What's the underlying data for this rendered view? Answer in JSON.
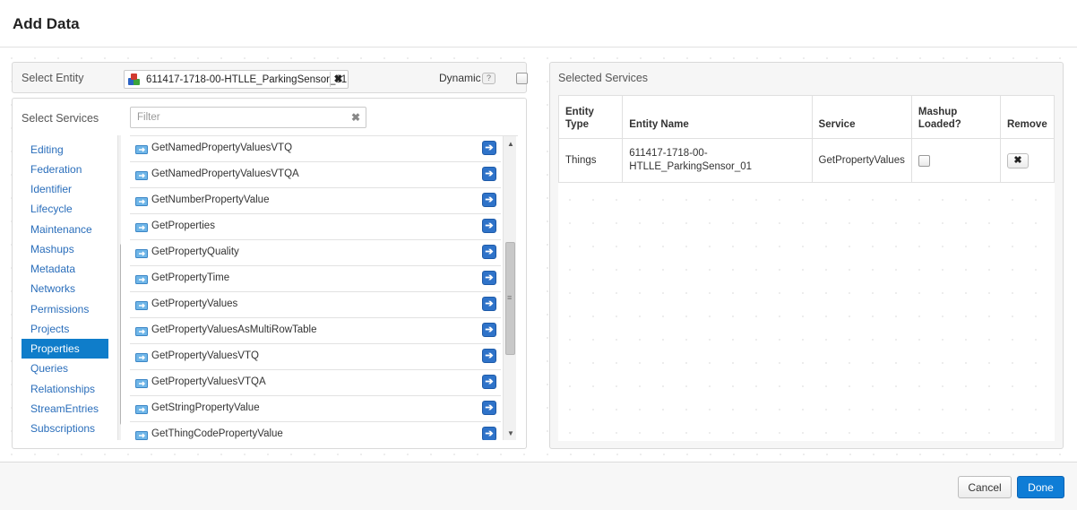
{
  "dialog": {
    "title": "Add Data"
  },
  "entity": {
    "label": "Select Entity",
    "selected": "611417-1718-00-HTLLE_ParkingSensor_01",
    "dynamic_label": "Dynamic",
    "help_badge": "?",
    "remove_glyph": "✖"
  },
  "services": {
    "label": "Select Services",
    "filter_placeholder": "Filter",
    "filter_clear_glyph": "✖",
    "categories": [
      {
        "label": "Editing"
      },
      {
        "label": "Federation"
      },
      {
        "label": "Identifier"
      },
      {
        "label": "Lifecycle"
      },
      {
        "label": "Maintenance"
      },
      {
        "label": "Mashups"
      },
      {
        "label": "Metadata"
      },
      {
        "label": "Networks"
      },
      {
        "label": "Permissions"
      },
      {
        "label": "Projects"
      },
      {
        "label": "Properties"
      },
      {
        "label": "Queries"
      },
      {
        "label": "Relationships"
      },
      {
        "label": "StreamEntries"
      },
      {
        "label": "Subscriptions"
      }
    ],
    "selected_category": "Properties",
    "list": [
      {
        "name": "GetNamedPropertyValuesVTQ"
      },
      {
        "name": "GetNamedPropertyValuesVTQA"
      },
      {
        "name": "GetNumberPropertyValue"
      },
      {
        "name": "GetProperties"
      },
      {
        "name": "GetPropertyQuality"
      },
      {
        "name": "GetPropertyTime"
      },
      {
        "name": "GetPropertyValues"
      },
      {
        "name": "GetPropertyValuesAsMultiRowTable"
      },
      {
        "name": "GetPropertyValuesVTQ"
      },
      {
        "name": "GetPropertyValuesVTQA"
      },
      {
        "name": "GetStringPropertyValue"
      },
      {
        "name": "GetThingCodePropertyValue"
      }
    ],
    "add_glyph": "➔"
  },
  "selected_services": {
    "label": "Selected Services",
    "columns": {
      "entity_type_1": "Entity",
      "entity_type_2": "Type",
      "entity_name": "Entity Name",
      "service": "Service",
      "mashup_1": "Mashup",
      "mashup_2": "Loaded?",
      "remove": "Remove"
    },
    "rows": [
      {
        "entity_type": "Things",
        "entity_name_1": "611417-1718-00-",
        "entity_name_2": "HTLLE_ParkingSensor_01",
        "service": "GetPropertyValues",
        "remove_glyph": "✖"
      }
    ]
  },
  "footer": {
    "cancel_label": "Cancel",
    "done_label": "Done"
  },
  "colors": {
    "accent": "#0f7dca",
    "link": "#2a6ebb",
    "add_button": "#2f73c9",
    "done_button": "#0f7dd6"
  }
}
